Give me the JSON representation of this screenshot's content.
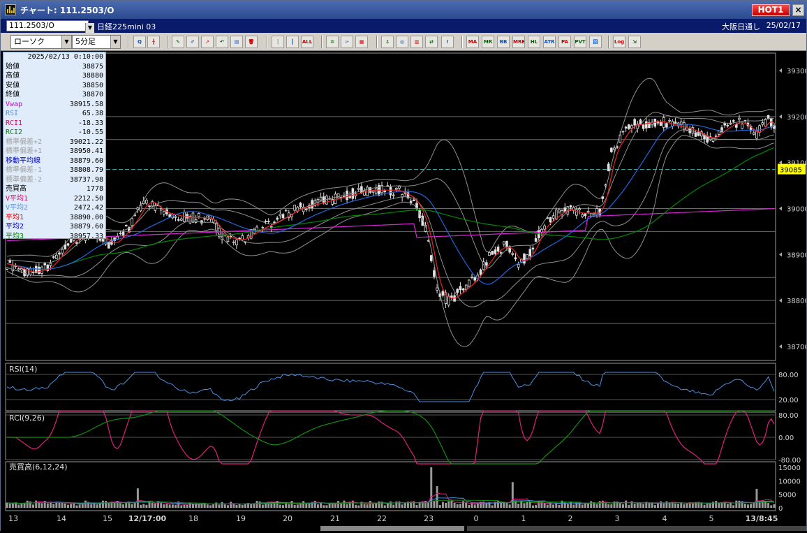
{
  "window": {
    "title": "チャート: 111.2503/O",
    "hot_label": "HOT1",
    "close_glyph": "×"
  },
  "infobar": {
    "symbol": "111.2503/O",
    "instrument": "日経225mini 03",
    "market": "大阪日通し",
    "date": "25/02/17"
  },
  "toolbar": {
    "chart_type": "ローソク",
    "timeframe": "5分足",
    "buttons": [
      {
        "name": "zoom-icon",
        "label": "Q"
      },
      {
        "name": "crosshair-icon",
        "label": "╫"
      },
      {
        "name": "pencil-icon",
        "label": "✎"
      },
      {
        "name": "draw-icon",
        "label": "✐"
      },
      {
        "name": "cursor-icon",
        "label": "➚"
      },
      {
        "name": "undo-icon",
        "label": "↶"
      },
      {
        "name": "memo-icon",
        "label": "▤"
      },
      {
        "name": "trash-icon",
        "label": "🗑"
      },
      {
        "name": "candle-icon",
        "label": "┆"
      },
      {
        "name": "bars-icon",
        "label": "║"
      },
      {
        "name": "all-icon",
        "label": "ALL"
      },
      {
        "name": "settings-icon",
        "label": "✲"
      },
      {
        "name": "brush-icon",
        "label": "✑"
      },
      {
        "name": "color-icon",
        "label": "▦"
      },
      {
        "name": "import-icon",
        "label": "⇩"
      },
      {
        "name": "search-chart-icon",
        "label": "◎"
      },
      {
        "name": "split-icon",
        "label": "▥"
      },
      {
        "name": "compare-icon",
        "label": "⇄"
      },
      {
        "name": "lock-icon",
        "label": "!"
      },
      {
        "name": "ma-icon",
        "label": "MA"
      },
      {
        "name": "mr-icon",
        "label": "MR"
      },
      {
        "name": "bb-icon",
        "label": "BB"
      },
      {
        "name": "mre-icon",
        "label": "MRE"
      },
      {
        "name": "hl-icon",
        "label": "HL"
      },
      {
        "name": "atr-icon",
        "label": "ATR"
      },
      {
        "name": "pa-icon",
        "label": "PA"
      },
      {
        "name": "pvt-icon",
        "label": "PVT"
      },
      {
        "name": "ichimoku-icon",
        "label": "回"
      },
      {
        "name": "log-icon",
        "label": "Log"
      },
      {
        "name": "export-icon",
        "label": "⇲"
      }
    ]
  },
  "datapanel": {
    "timestamp": "2025/02/13  0:10:00",
    "rows": [
      {
        "label": "始値",
        "value": "38875",
        "color": "#000000"
      },
      {
        "label": "高値",
        "value": "38880",
        "color": "#000000"
      },
      {
        "label": "安値",
        "value": "38850",
        "color": "#000000"
      },
      {
        "label": "終値",
        "value": "38870",
        "color": "#000000"
      },
      {
        "label": "Vwap",
        "value": "38915.58",
        "color": "#cc00cc"
      },
      {
        "label": "RSI",
        "value": "65.38",
        "color": "#5b8fd8"
      },
      {
        "label": "RCI1",
        "value": "-18.33",
        "color": "#dd0066"
      },
      {
        "label": "RCI2",
        "value": "-10.55",
        "color": "#008800"
      },
      {
        "label": "標準偏差+2",
        "value": "39021.22",
        "color": "#a0a0a0"
      },
      {
        "label": "標準偏差+1",
        "value": "38950.41",
        "color": "#a0a0a0"
      },
      {
        "label": "移動平均線",
        "value": "38879.60",
        "color": "#0000bb"
      },
      {
        "label": "標準偏差-1",
        "value": "38808.79",
        "color": "#a0a0a0"
      },
      {
        "label": "標準偏差-2",
        "value": "38737.98",
        "color": "#a0a0a0"
      },
      {
        "label": "売買高",
        "value": "1778",
        "color": "#000000"
      },
      {
        "label": "V平均1",
        "value": "2212.50",
        "color": "#dd0066"
      },
      {
        "label": "V平均2",
        "value": "2472.42",
        "color": "#5b8fd8"
      },
      {
        "label": "平均1",
        "value": "38890.00",
        "color": "#dd0000"
      },
      {
        "label": "平均2",
        "value": "38879.60",
        "color": "#0000cc"
      },
      {
        "label": "平均3",
        "value": "38957.33",
        "color": "#008800"
      }
    ]
  },
  "chart_data": [
    {
      "type": "candlestick",
      "price_ticks": [
        39300,
        39200,
        39100,
        39000,
        38900,
        38800,
        38700
      ],
      "ylim": [
        38700,
        39300
      ],
      "current_price": 39085,
      "x_labels": [
        "13",
        "14",
        "15",
        "12/17:00",
        "18",
        "19",
        "20",
        "21",
        "22",
        "23",
        "0",
        "1",
        "2",
        "3",
        "4",
        "5",
        "13/8:45"
      ]
    },
    {
      "type": "line",
      "title": "RSI(14)",
      "y_ticks": [
        "80.00",
        "20.00"
      ],
      "ylim": [
        0,
        100
      ]
    },
    {
      "type": "line",
      "title": "RCI(9,26)",
      "y_ticks": [
        "80.00",
        "0.00",
        "-80.00"
      ],
      "ylim": [
        -100,
        100
      ]
    },
    {
      "type": "bar",
      "title": "売買高(6,12,24)",
      "y_ticks": [
        "15000",
        "10000",
        "5000",
        "0"
      ],
      "ylim": [
        0,
        16000
      ]
    }
  ]
}
